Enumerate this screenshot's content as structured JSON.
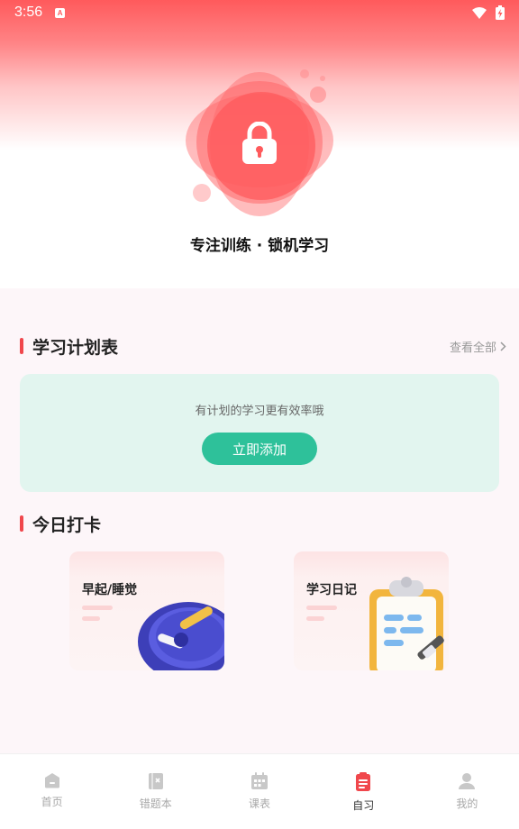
{
  "status_bar": {
    "time": "3:56",
    "notification_badge": "A",
    "icons": [
      "wifi-icon",
      "battery-charging-icon"
    ]
  },
  "hero": {
    "icon": "lock-icon",
    "caption": "专注训练 · 锁机学习",
    "colors": {
      "accent": "#ff5a5c",
      "blob": "#ff6b6d"
    }
  },
  "plan": {
    "title": "学习计划表",
    "view_all": "查看全部",
    "hint": "有计划的学习更有效率哦",
    "add_button": "立即添加",
    "colors": {
      "card_bg": "#e2f5ef",
      "button_bg": "#2ec19a"
    }
  },
  "checkin": {
    "title": "今日打卡",
    "cards": [
      {
        "label": "早起/睡觉",
        "icon": "alarm-clock-icon"
      },
      {
        "label": "学习日记",
        "icon": "clipboard-icon"
      }
    ]
  },
  "tabbar": {
    "active_index": 3,
    "items": [
      {
        "label": "首页",
        "icon": "home-icon"
      },
      {
        "label": "错题本",
        "icon": "wrong-book-icon"
      },
      {
        "label": "课表",
        "icon": "calendar-icon"
      },
      {
        "label": "自习",
        "icon": "self-study-icon"
      },
      {
        "label": "我的",
        "icon": "user-icon"
      }
    ],
    "colors": {
      "active": "#f0474c",
      "inactive": "#c8c8c8"
    }
  }
}
